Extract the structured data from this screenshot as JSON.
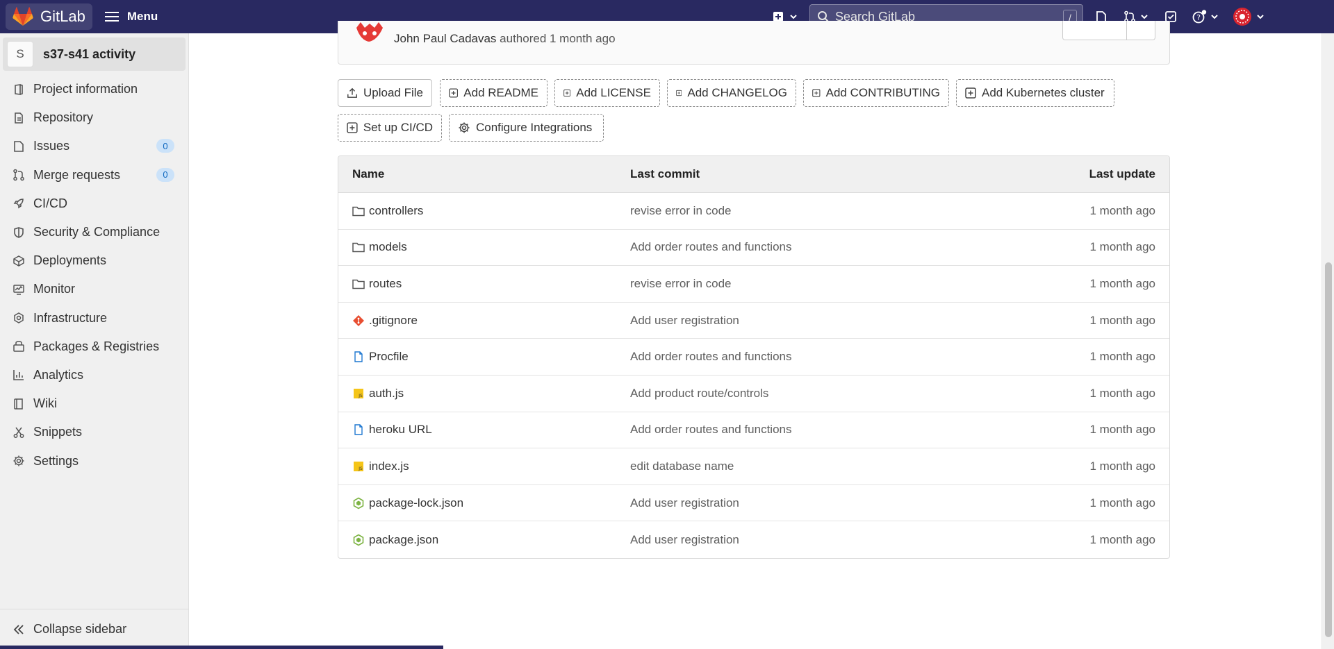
{
  "navbar": {
    "brand": "GitLab",
    "menu_label": "Menu",
    "search_placeholder": "Search GitLab",
    "search_shortcut": "/",
    "icons": [
      "plus-square-icon",
      "todo-doc-icon",
      "merge-request-icon",
      "check-square-icon",
      "help-icon",
      "avatar-icon"
    ]
  },
  "sidebar": {
    "project_avatar": "S",
    "project_name": "s37-s41 activity",
    "items": [
      {
        "label": "Project information",
        "icon": "project-icon"
      },
      {
        "label": "Repository",
        "icon": "doc-icon"
      },
      {
        "label": "Issues",
        "icon": "issues-icon",
        "badge": "0"
      },
      {
        "label": "Merge requests",
        "icon": "merge-request-icon",
        "badge": "0"
      },
      {
        "label": "CI/CD",
        "icon": "rocket-icon"
      },
      {
        "label": "Security & Compliance",
        "icon": "shield-icon"
      },
      {
        "label": "Deployments",
        "icon": "deploy-icon"
      },
      {
        "label": "Monitor",
        "icon": "monitor-icon"
      },
      {
        "label": "Infrastructure",
        "icon": "cloud-gear-icon"
      },
      {
        "label": "Packages & Registries",
        "icon": "package-icon"
      },
      {
        "label": "Analytics",
        "icon": "chart-icon"
      },
      {
        "label": "Wiki",
        "icon": "book-icon"
      },
      {
        "label": "Snippets",
        "icon": "scissors-icon"
      },
      {
        "label": "Settings",
        "icon": "gear-icon"
      }
    ],
    "collapse_label": "Collapse sidebar"
  },
  "commit": {
    "author": "John Paul Cadavas",
    "action": "authored 1 month ago"
  },
  "actions": {
    "upload": "Upload File",
    "readme": "Add README",
    "license": "Add LICENSE",
    "changelog": "Add CHANGELOG",
    "contributing": "Add CONTRIBUTING",
    "kubernetes": "Add Kubernetes cluster",
    "cicd": "Set up CI/CD",
    "integrations": "Configure Integrations"
  },
  "files": {
    "headers": {
      "name": "Name",
      "commit": "Last commit",
      "update": "Last update"
    },
    "rows": [
      {
        "name": "controllers",
        "type": "folder",
        "commit": "revise error in code",
        "update": "1 month ago"
      },
      {
        "name": "models",
        "type": "folder",
        "commit": "Add order routes and functions",
        "update": "1 month ago"
      },
      {
        "name": "routes",
        "type": "folder",
        "commit": "revise error in code",
        "update": "1 month ago"
      },
      {
        "name": ".gitignore",
        "type": "git",
        "commit": "Add user registration",
        "update": "1 month ago"
      },
      {
        "name": "Procfile",
        "type": "file",
        "commit": "Add order routes and functions",
        "update": "1 month ago"
      },
      {
        "name": "auth.js",
        "type": "js",
        "commit": "Add product route/controls",
        "update": "1 month ago"
      },
      {
        "name": "heroku URL",
        "type": "file",
        "commit": "Add order routes and functions",
        "update": "1 month ago"
      },
      {
        "name": "index.js",
        "type": "js",
        "commit": "edit database name",
        "update": "1 month ago"
      },
      {
        "name": "package-lock.json",
        "type": "node",
        "commit": "Add user registration",
        "update": "1 month ago"
      },
      {
        "name": "package.json",
        "type": "node",
        "commit": "Add user registration",
        "update": "1 month ago"
      }
    ]
  },
  "colors": {
    "navbar": "#292961",
    "sidebar": "#f0f0f0",
    "badge_bg": "#cbe2f9",
    "badge_text": "#1068bf",
    "gitlab_orange": "#fc6d26"
  }
}
